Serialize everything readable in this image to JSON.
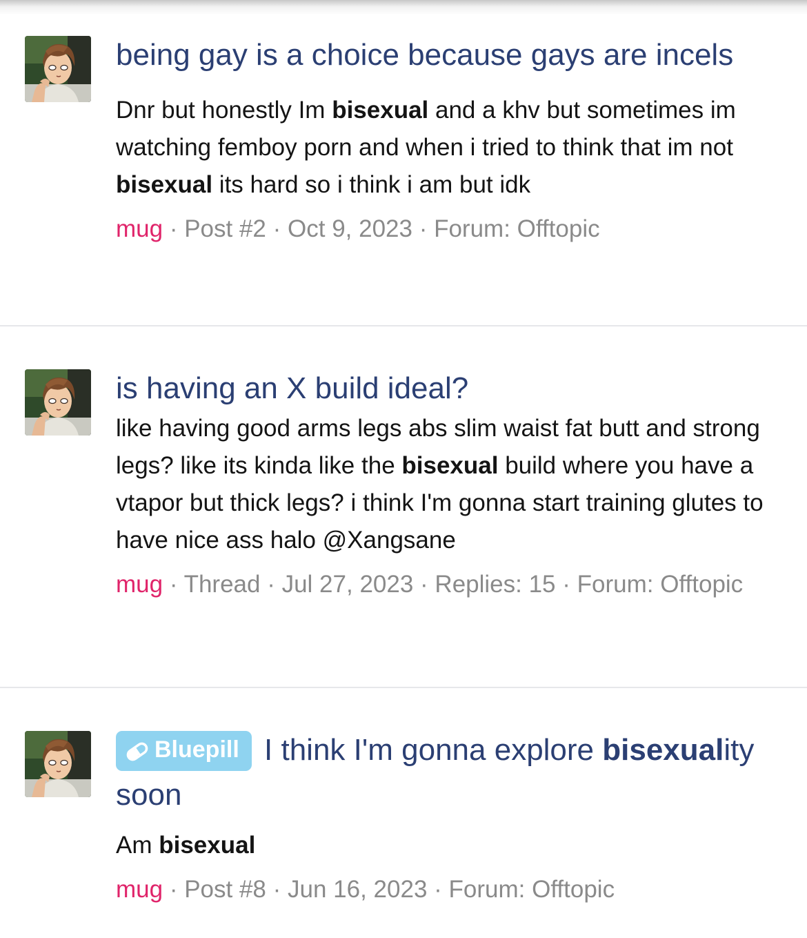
{
  "results": [
    {
      "title": [
        {
          "text": "being gay is a choice because gays are incels",
          "bold": false
        }
      ],
      "snippet": [
        {
          "text": "Dnr but honestly Im ",
          "bold": false
        },
        {
          "text": "bisexual",
          "bold": true
        },
        {
          "text": " and a khv but sometimes im watching femboy porn and when i tried to think that im not ",
          "bold": false
        },
        {
          "text": "bisexual",
          "bold": true
        },
        {
          "text": " its hard so i think i am but idk",
          "bold": false
        }
      ],
      "meta": {
        "user": "mug",
        "parts": [
          "Post #2",
          "Oct 9, 2023",
          "Forum: Offtopic"
        ]
      }
    },
    {
      "title": [
        {
          "text": "is having an X build ideal?",
          "bold": false
        }
      ],
      "snippet": [
        {
          "text": "like having good arms legs abs slim waist fat butt and strong legs? like its kinda like the ",
          "bold": false
        },
        {
          "text": "bisexual",
          "bold": true
        },
        {
          "text": " build where you have a vtapor but thick legs? i think I'm gonna start training glutes to have nice ass halo @Xangsane",
          "bold": false
        }
      ],
      "meta": {
        "user": "mug",
        "parts": [
          "Thread",
          "Jul 27, 2023",
          "Replies: 15",
          "Forum: Offtopic"
        ]
      }
    },
    {
      "prefix": {
        "label": "Bluepill",
        "icon": "pill-icon",
        "color": "#8fd3f0"
      },
      "title": [
        {
          "text": " I think I'm gonna explore ",
          "bold": false
        },
        {
          "text": "bisexual",
          "bold": true
        },
        {
          "text": "ity soon",
          "bold": false
        }
      ],
      "snippet": [
        {
          "text": "Am ",
          "bold": false
        },
        {
          "text": "bisexual",
          "bold": true
        }
      ],
      "meta": {
        "user": "mug",
        "parts": [
          "Post #8",
          "Jun 16, 2023",
          "Forum: Offtopic"
        ]
      }
    }
  ],
  "meta_separator": " · ",
  "colors": {
    "title": "#2b3f73",
    "username": "#e0246a",
    "meta": "#8a8a8a",
    "prefix_badge": "#8fd3f0"
  }
}
